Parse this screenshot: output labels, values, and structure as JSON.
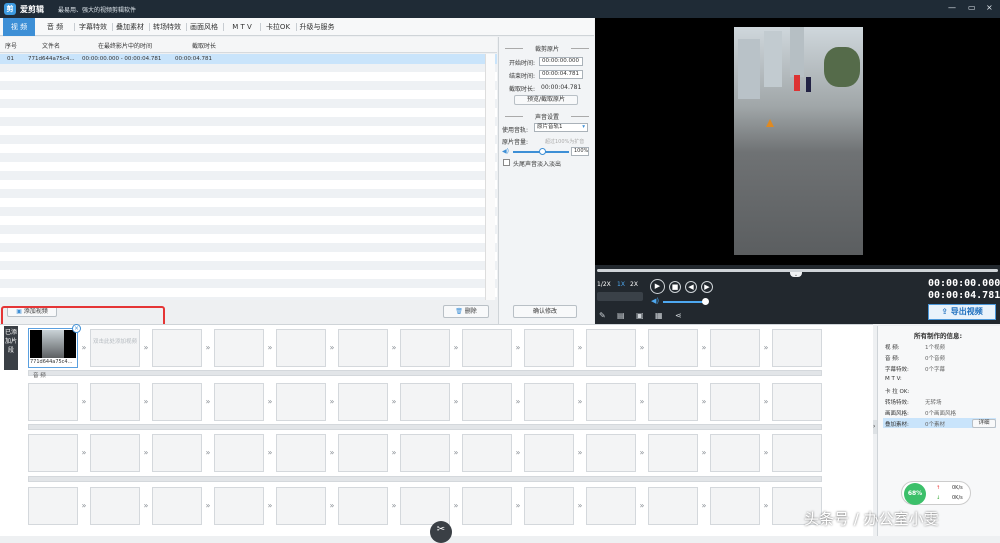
{
  "app": {
    "name": "爱剪辑",
    "slogan": "最易用、强大的视频剪辑软件"
  },
  "window_controls": [
    "—",
    "▭",
    "×"
  ],
  "tabs": [
    "视 频",
    "音 频",
    "字幕特效",
    "叠加素材",
    "转场特效",
    "画面风格",
    "M T V",
    "卡拉OK",
    "升级与服务"
  ],
  "file_list": {
    "headers": [
      "序号",
      "文件名",
      "在最终影片中的时间",
      "截取时长"
    ],
    "rows": [
      {
        "index": "01",
        "name": "771d644a75c4...",
        "time": "00:00:00.000 - 00:00:04.781",
        "duration": "00:00:04.781"
      }
    ]
  },
  "buttons": {
    "add_video": "添加视频",
    "delete": "删除",
    "confirm": "确认修改",
    "preview_clip": "预览/截取原片",
    "export": "导出视频",
    "detail": "详细"
  },
  "clip_panel": {
    "title": "裁剪原片",
    "start_label": "开始时间:",
    "start_value": "00:00:00.000",
    "end_label": "结束时间:",
    "end_value": "00:00:04.781",
    "dur_label": "截取时长:",
    "dur_value": "00:00:04.781"
  },
  "audio_panel": {
    "title": "声音设置",
    "track_label": "使用音轨:",
    "track_value": "原片音轨1",
    "vol_label": "原片音量:",
    "vol_hint": "超过100%为扩音",
    "vol_value": "100%",
    "fade_label": "头尾声音淡入淡出"
  },
  "player": {
    "speeds": [
      "1/2X",
      "1X",
      "2X"
    ],
    "time_current": "00:00:00.000",
    "time_total": "00:00:04.781",
    "progress": 0.0
  },
  "timeline": {
    "side_label": "已添加片段",
    "clip_name": "771d644a75c4...",
    "placeholder": "双击此处添加视频",
    "audio_label": "音 频"
  },
  "info": {
    "title": "所有制作的信息:",
    "rows": [
      {
        "k": "视 频:",
        "v": "1个视频"
      },
      {
        "k": "音 频:",
        "v": "0个音频"
      },
      {
        "k": "字幕特效:",
        "v": "0个字幕"
      },
      {
        "k": "M T V:",
        "v": ""
      },
      {
        "k": "卡 拉 OK:",
        "v": ""
      },
      {
        "k": "转场特效:",
        "v": "无转场"
      },
      {
        "k": "画面风格:",
        "v": "0个画面风格"
      },
      {
        "k": "叠加素材:",
        "v": "0个素材"
      }
    ]
  },
  "network": {
    "percent": "68%",
    "up": "0K/s",
    "down": "0K/s"
  },
  "watermark": "头条号 / 办公室小雯"
}
